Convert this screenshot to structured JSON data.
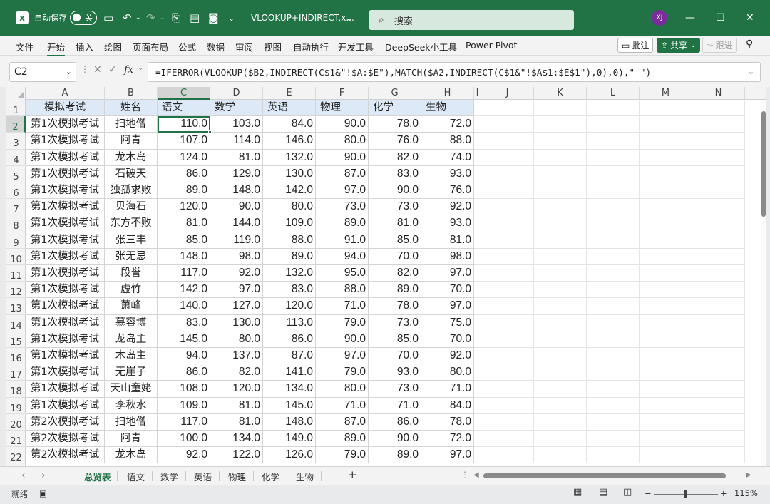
{
  "titlebar": {
    "autosave_label": "自动保存",
    "autosave_state": "关",
    "file_name": "VLOOKUP+INDIRECT.x...",
    "search_placeholder": "搜索",
    "user_initials": "XJ"
  },
  "ribbon": {
    "tabs": [
      "文件",
      "开始",
      "插入",
      "绘图",
      "页面布局",
      "公式",
      "数据",
      "审阅",
      "视图",
      "自动执行",
      "开发工具",
      "DeepSeek小工具",
      "Power Pivot"
    ],
    "active_tab": "开始",
    "comments_label": "批注",
    "share_label": "共享",
    "catchup_label": "跟进"
  },
  "formula_bar": {
    "name_box": "C2",
    "fx": "fx",
    "formula": "=IFERROR(VLOOKUP($B2,INDIRECT(C$1&\"!$A:$E\"),MATCH($A2,INDIRECT(C$1&\"!$A$1:$E$1\"),0),0),\"-\")"
  },
  "sheet": {
    "columns": [
      "A",
      "B",
      "C",
      "D",
      "E",
      "F",
      "G",
      "H",
      "I",
      "J",
      "K",
      "L",
      "M",
      "N"
    ],
    "selected_column": "C",
    "selected_row": 2,
    "active_cell": "C2",
    "header_row": [
      "模拟考试",
      "姓名",
      "语文",
      "数学",
      "英语",
      "物理",
      "化学",
      "生物"
    ],
    "rows": [
      [
        "第1次模拟考试",
        "扫地僧",
        "110.0",
        "103.0",
        "84.0",
        "90.0",
        "78.0",
        "72.0"
      ],
      [
        "第1次模拟考试",
        "阿青",
        "107.0",
        "114.0",
        "146.0",
        "80.0",
        "76.0",
        "88.0"
      ],
      [
        "第1次模拟考试",
        "龙木岛",
        "124.0",
        "81.0",
        "132.0",
        "90.0",
        "82.0",
        "74.0"
      ],
      [
        "第1次模拟考试",
        "石破天",
        "86.0",
        "129.0",
        "130.0",
        "87.0",
        "83.0",
        "93.0"
      ],
      [
        "第1次模拟考试",
        "独孤求败",
        "89.0",
        "148.0",
        "142.0",
        "97.0",
        "90.0",
        "76.0"
      ],
      [
        "第1次模拟考试",
        "贝海石",
        "120.0",
        "90.0",
        "80.0",
        "73.0",
        "73.0",
        "92.0"
      ],
      [
        "第1次模拟考试",
        "东方不败",
        "81.0",
        "144.0",
        "109.0",
        "89.0",
        "81.0",
        "93.0"
      ],
      [
        "第1次模拟考试",
        "张三丰",
        "85.0",
        "119.0",
        "88.0",
        "91.0",
        "85.0",
        "81.0"
      ],
      [
        "第1次模拟考试",
        "张无忌",
        "148.0",
        "98.0",
        "89.0",
        "94.0",
        "70.0",
        "98.0"
      ],
      [
        "第1次模拟考试",
        "段誉",
        "117.0",
        "92.0",
        "132.0",
        "95.0",
        "82.0",
        "97.0"
      ],
      [
        "第1次模拟考试",
        "虚竹",
        "142.0",
        "97.0",
        "83.0",
        "88.0",
        "89.0",
        "70.0"
      ],
      [
        "第1次模拟考试",
        "萧峰",
        "140.0",
        "127.0",
        "120.0",
        "71.0",
        "78.0",
        "97.0"
      ],
      [
        "第1次模拟考试",
        "慕容博",
        "83.0",
        "130.0",
        "113.0",
        "79.0",
        "73.0",
        "75.0"
      ],
      [
        "第1次模拟考试",
        "龙岛主",
        "145.0",
        "80.0",
        "86.0",
        "90.0",
        "85.0",
        "70.0"
      ],
      [
        "第1次模拟考试",
        "木岛主",
        "94.0",
        "137.0",
        "87.0",
        "97.0",
        "70.0",
        "92.0"
      ],
      [
        "第1次模拟考试",
        "无崖子",
        "86.0",
        "82.0",
        "141.0",
        "79.0",
        "93.0",
        "80.0"
      ],
      [
        "第1次模拟考试",
        "天山童姥",
        "108.0",
        "120.0",
        "134.0",
        "80.0",
        "73.0",
        "71.0"
      ],
      [
        "第1次模拟考试",
        "李秋水",
        "109.0",
        "81.0",
        "145.0",
        "71.0",
        "71.0",
        "84.0"
      ],
      [
        "第2次模拟考试",
        "扫地僧",
        "117.0",
        "81.0",
        "148.0",
        "87.0",
        "86.0",
        "78.0"
      ],
      [
        "第2次模拟考试",
        "阿青",
        "100.0",
        "134.0",
        "149.0",
        "89.0",
        "90.0",
        "72.0"
      ],
      [
        "第2次模拟考试",
        "龙木岛",
        "92.0",
        "122.0",
        "126.0",
        "79.0",
        "89.0",
        "97.0"
      ]
    ],
    "row_numbers": [
      "1",
      "2",
      "3",
      "4",
      "5",
      "6",
      "7",
      "8",
      "9",
      "10",
      "11",
      "12",
      "13",
      "14",
      "15",
      "16",
      "17",
      "18",
      "19",
      "20",
      "21",
      "22"
    ]
  },
  "sheet_tabs": {
    "tabs": [
      "总览表",
      "语文",
      "数学",
      "英语",
      "物理",
      "化学",
      "生物"
    ],
    "active": "总览表",
    "add": "+"
  },
  "statusbar": {
    "ready": "就绪",
    "zoom_label": "115%",
    "zoom_percent": 115
  },
  "colors": {
    "accent": "#217346",
    "header_fill": "#dde9f6"
  }
}
